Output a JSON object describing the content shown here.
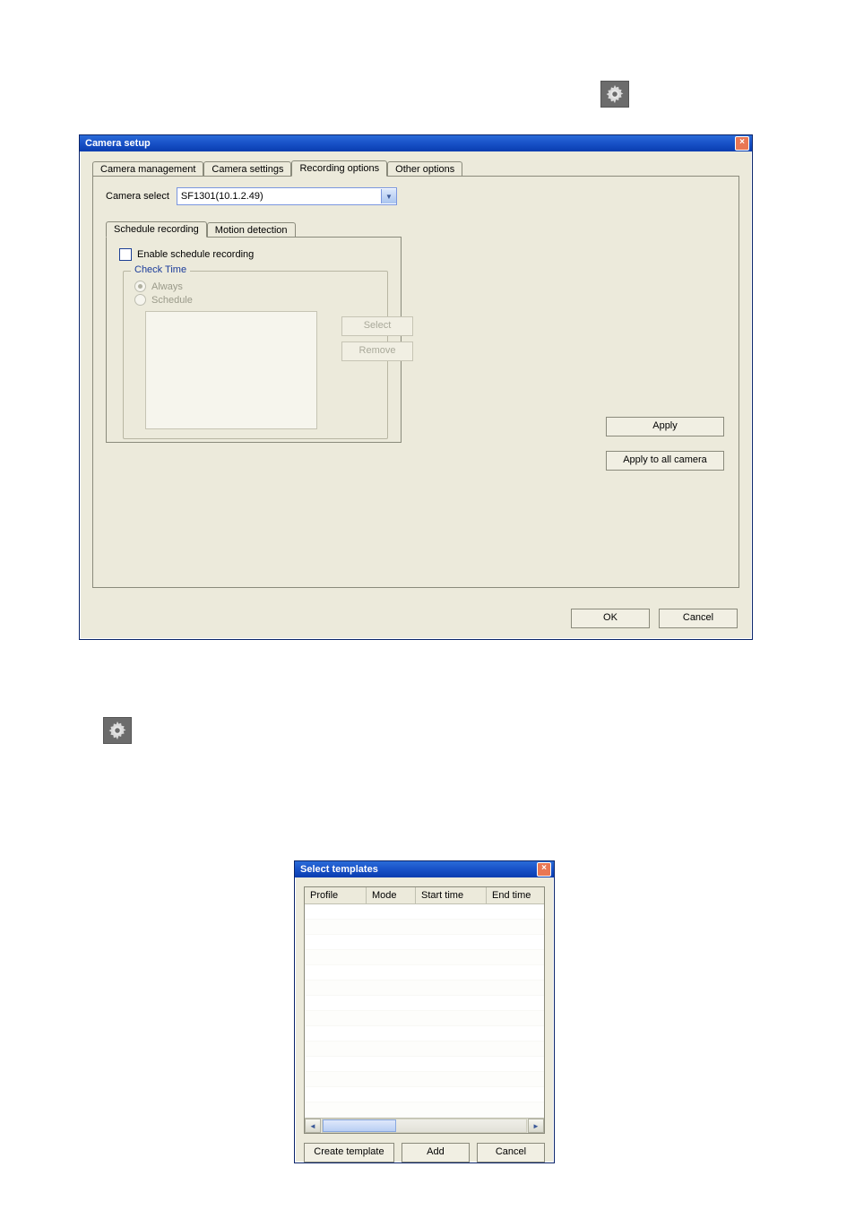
{
  "gear_icon_name": "settings-gear-icon",
  "main_window": {
    "title": "Camera setup",
    "tabs": [
      "Camera management",
      "Camera settings",
      "Recording options",
      "Other options"
    ],
    "active_tab_index": 2,
    "camera_select_label": "Camera select",
    "camera_select_value": "SF1301(10.1.2.49)",
    "inner_tabs": [
      "Schedule recording",
      "Motion detection"
    ],
    "inner_active_index": 0,
    "enable_schedule_label": "Enable schedule recording",
    "enable_schedule_checked": false,
    "check_time": {
      "group_label": "Check Time",
      "options": [
        "Always",
        "Schedule"
      ],
      "selected_index": 0
    },
    "select_btn": "Select",
    "remove_btn": "Remove",
    "apply_btn": "Apply",
    "apply_all_btn": "Apply to all camera",
    "ok_btn": "OK",
    "cancel_btn": "Cancel"
  },
  "templates_window": {
    "title": "Select templates",
    "columns": [
      "Profile",
      "Mode",
      "Start time",
      "End time"
    ],
    "create_btn": "Create template",
    "add_btn": "Add",
    "cancel_btn": "Cancel"
  }
}
